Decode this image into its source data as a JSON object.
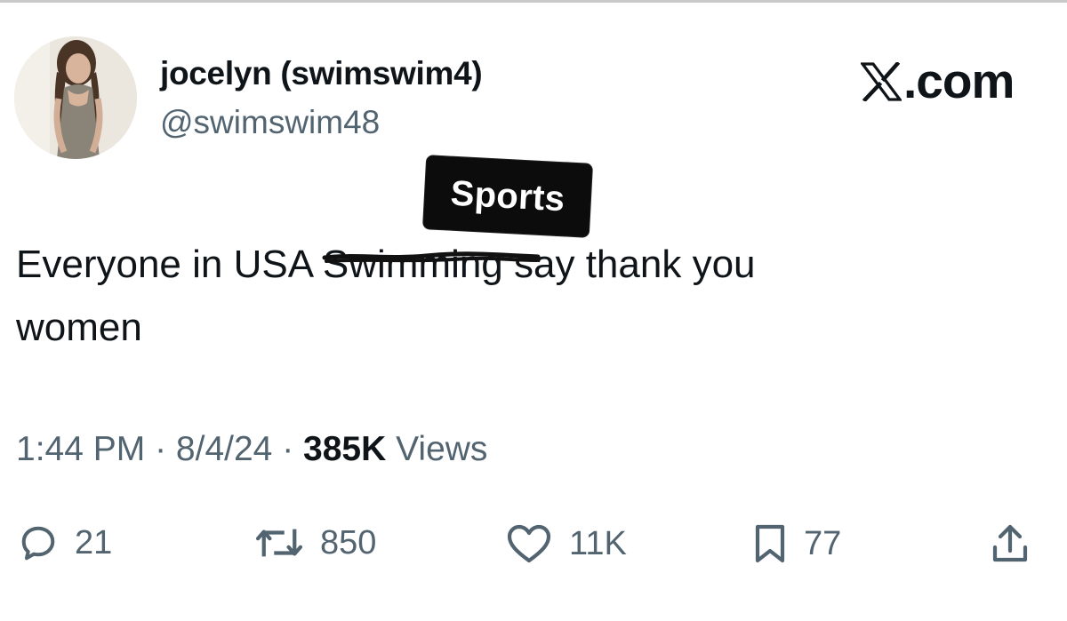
{
  "tweet": {
    "author": {
      "display_name": "jocelyn (swimswim4)",
      "handle": "@swimswim48"
    },
    "brand": {
      "label": ".com"
    },
    "sticker_label": "Sports",
    "text": {
      "before": "Everyone in USA ",
      "struck_word": "Swimming",
      "after": " say thank you",
      "line2": "women"
    },
    "meta": {
      "time": "1:44 PM",
      "date": "8/4/24",
      "views_count": "385K",
      "views_label": "Views"
    },
    "actions": {
      "replies": "21",
      "reposts": "850",
      "likes": "11K",
      "bookmarks": "77"
    }
  }
}
